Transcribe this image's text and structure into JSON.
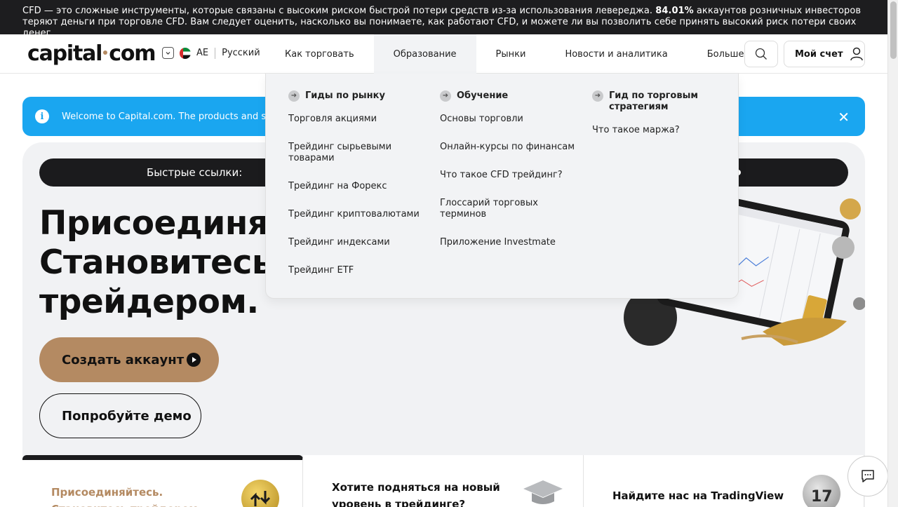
{
  "risk_warning": {
    "pre": "CFD — это сложные инструменты, которые связаны с высоким риском быстрой потери средств из-за использования левереджа. ",
    "percent": "84.01%",
    "post": " аккаунтов розничных инвесторов теряют деньги при торговле CFD. Вам следует оценить, насколько вы понимаете, как работают CFD, и можете ли вы позволить себе принять высокий риск потери своих денег."
  },
  "header": {
    "logo_left": "capital",
    "logo_right": "com",
    "region": "AE",
    "language": "Русский",
    "nav": [
      "Как торговать",
      "Образование",
      "Рынки",
      "Новости и аналитика",
      "Больше"
    ],
    "account_label": "Мой счет"
  },
  "banner": {
    "text": "Welcome to Capital.com. The products and servi"
  },
  "quick_links": {
    "label": "Быстрые ссылки:"
  },
  "hero": {
    "line1": "Присоединяйт",
    "line2": "Становитесь",
    "line3": "трейдером.",
    "cta": "Создать аккаунт",
    "demo": "Попробуйте демо"
  },
  "cards": [
    {
      "line1": "Присоединяйтесь.",
      "line2": "Становитесь трейдером."
    },
    {
      "line1": "Хотите подняться на новый",
      "line2": "уровень в трейдинге?"
    },
    {
      "line1": "Найдите нас на TradingView",
      "line2": ""
    }
  ],
  "dropdown": {
    "columns": [
      {
        "heading": "Гиды по рынку",
        "items": [
          "Торговля акциями",
          "Трейдинг сырьевыми товарами",
          "Трейдинг на Форекс",
          "Трейдинг криптовалютами",
          "Трейдинг индексами",
          "Трейдинг ETF"
        ]
      },
      {
        "heading": "Обучение",
        "items": [
          "Основы торговли",
          "Онлайн-курсы по финансам",
          "Что такое CFD трейдинг?",
          "Глоссарий торговых терминов",
          "Приложение Investmate"
        ]
      },
      {
        "heading": "Гид по торговым стратегиям",
        "items": [
          "Что такое маржа?"
        ]
      }
    ]
  },
  "colors": {
    "brand": "#b48a62",
    "banner": "#1aa6f0",
    "dark": "#1b1b1d"
  }
}
